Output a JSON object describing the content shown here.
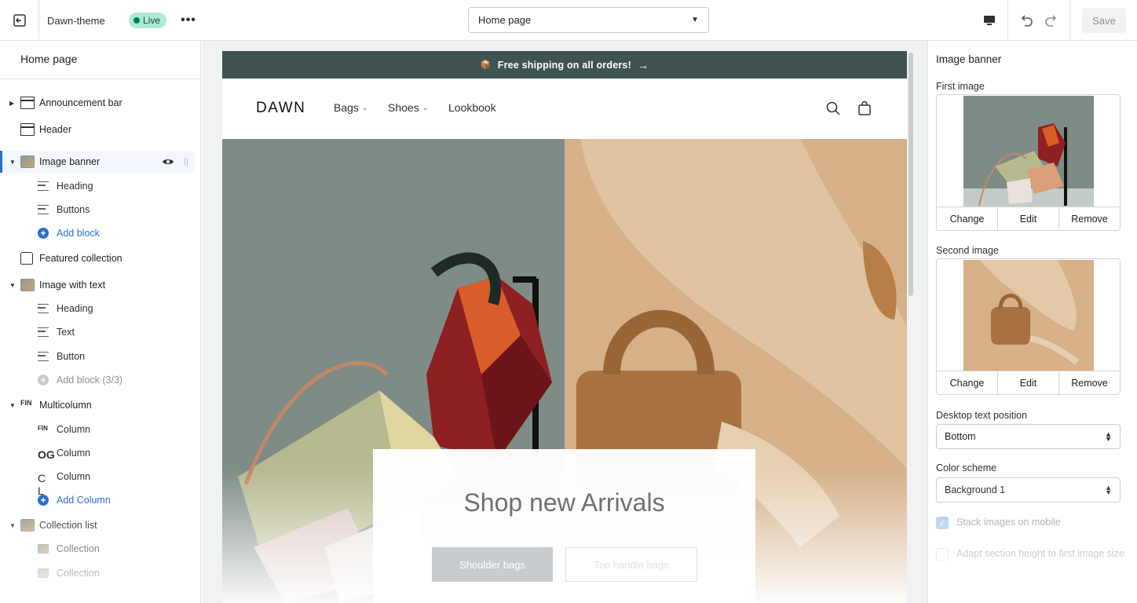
{
  "topbar": {
    "theme_name": "Dawn-theme",
    "status_badge": "Live",
    "page_select": "Home page",
    "save_label": "Save"
  },
  "sidebar": {
    "title": "Home page",
    "items": [
      {
        "label": "Announcement bar"
      },
      {
        "label": "Header"
      },
      {
        "label": "Image banner"
      },
      {
        "label": "Heading"
      },
      {
        "label": "Buttons"
      },
      {
        "label": "Add block"
      },
      {
        "label": "Featured collection"
      },
      {
        "label": "Image with text"
      },
      {
        "label": "Heading"
      },
      {
        "label": "Text"
      },
      {
        "label": "Button"
      },
      {
        "label": "Add block (3/3)"
      },
      {
        "label": "Multicolumn"
      },
      {
        "label": "Column"
      },
      {
        "label": "Column"
      },
      {
        "label": "Column"
      },
      {
        "label": "Add Column"
      },
      {
        "label": "Collection list"
      },
      {
        "label": "Collection"
      },
      {
        "label": "Collection"
      }
    ]
  },
  "preview": {
    "announcement": "Free shipping on all orders!",
    "logo": "DAWN",
    "nav": [
      "Bags",
      "Shoes",
      "Lookbook"
    ],
    "banner_heading": "Shop new Arrivals",
    "button_primary": "Shoulder bags",
    "button_secondary": "Top handle bags"
  },
  "settings": {
    "title": "Image banner",
    "first_image_label": "First image",
    "second_image_label": "Second image",
    "image_actions": [
      "Change",
      "Edit",
      "Remove"
    ],
    "desktop_text_position_label": "Desktop text position",
    "desktop_text_position_value": "Bottom",
    "color_scheme_label": "Color scheme",
    "color_scheme_value": "Background 1",
    "stack_images_label": "Stack images on mobile",
    "adapt_height_label": "Adapt section height to first image size"
  },
  "colors": {
    "accent": "#2c6ecb",
    "announcement_bg": "#3f5450",
    "live_badge_bg": "#aee9d1"
  }
}
